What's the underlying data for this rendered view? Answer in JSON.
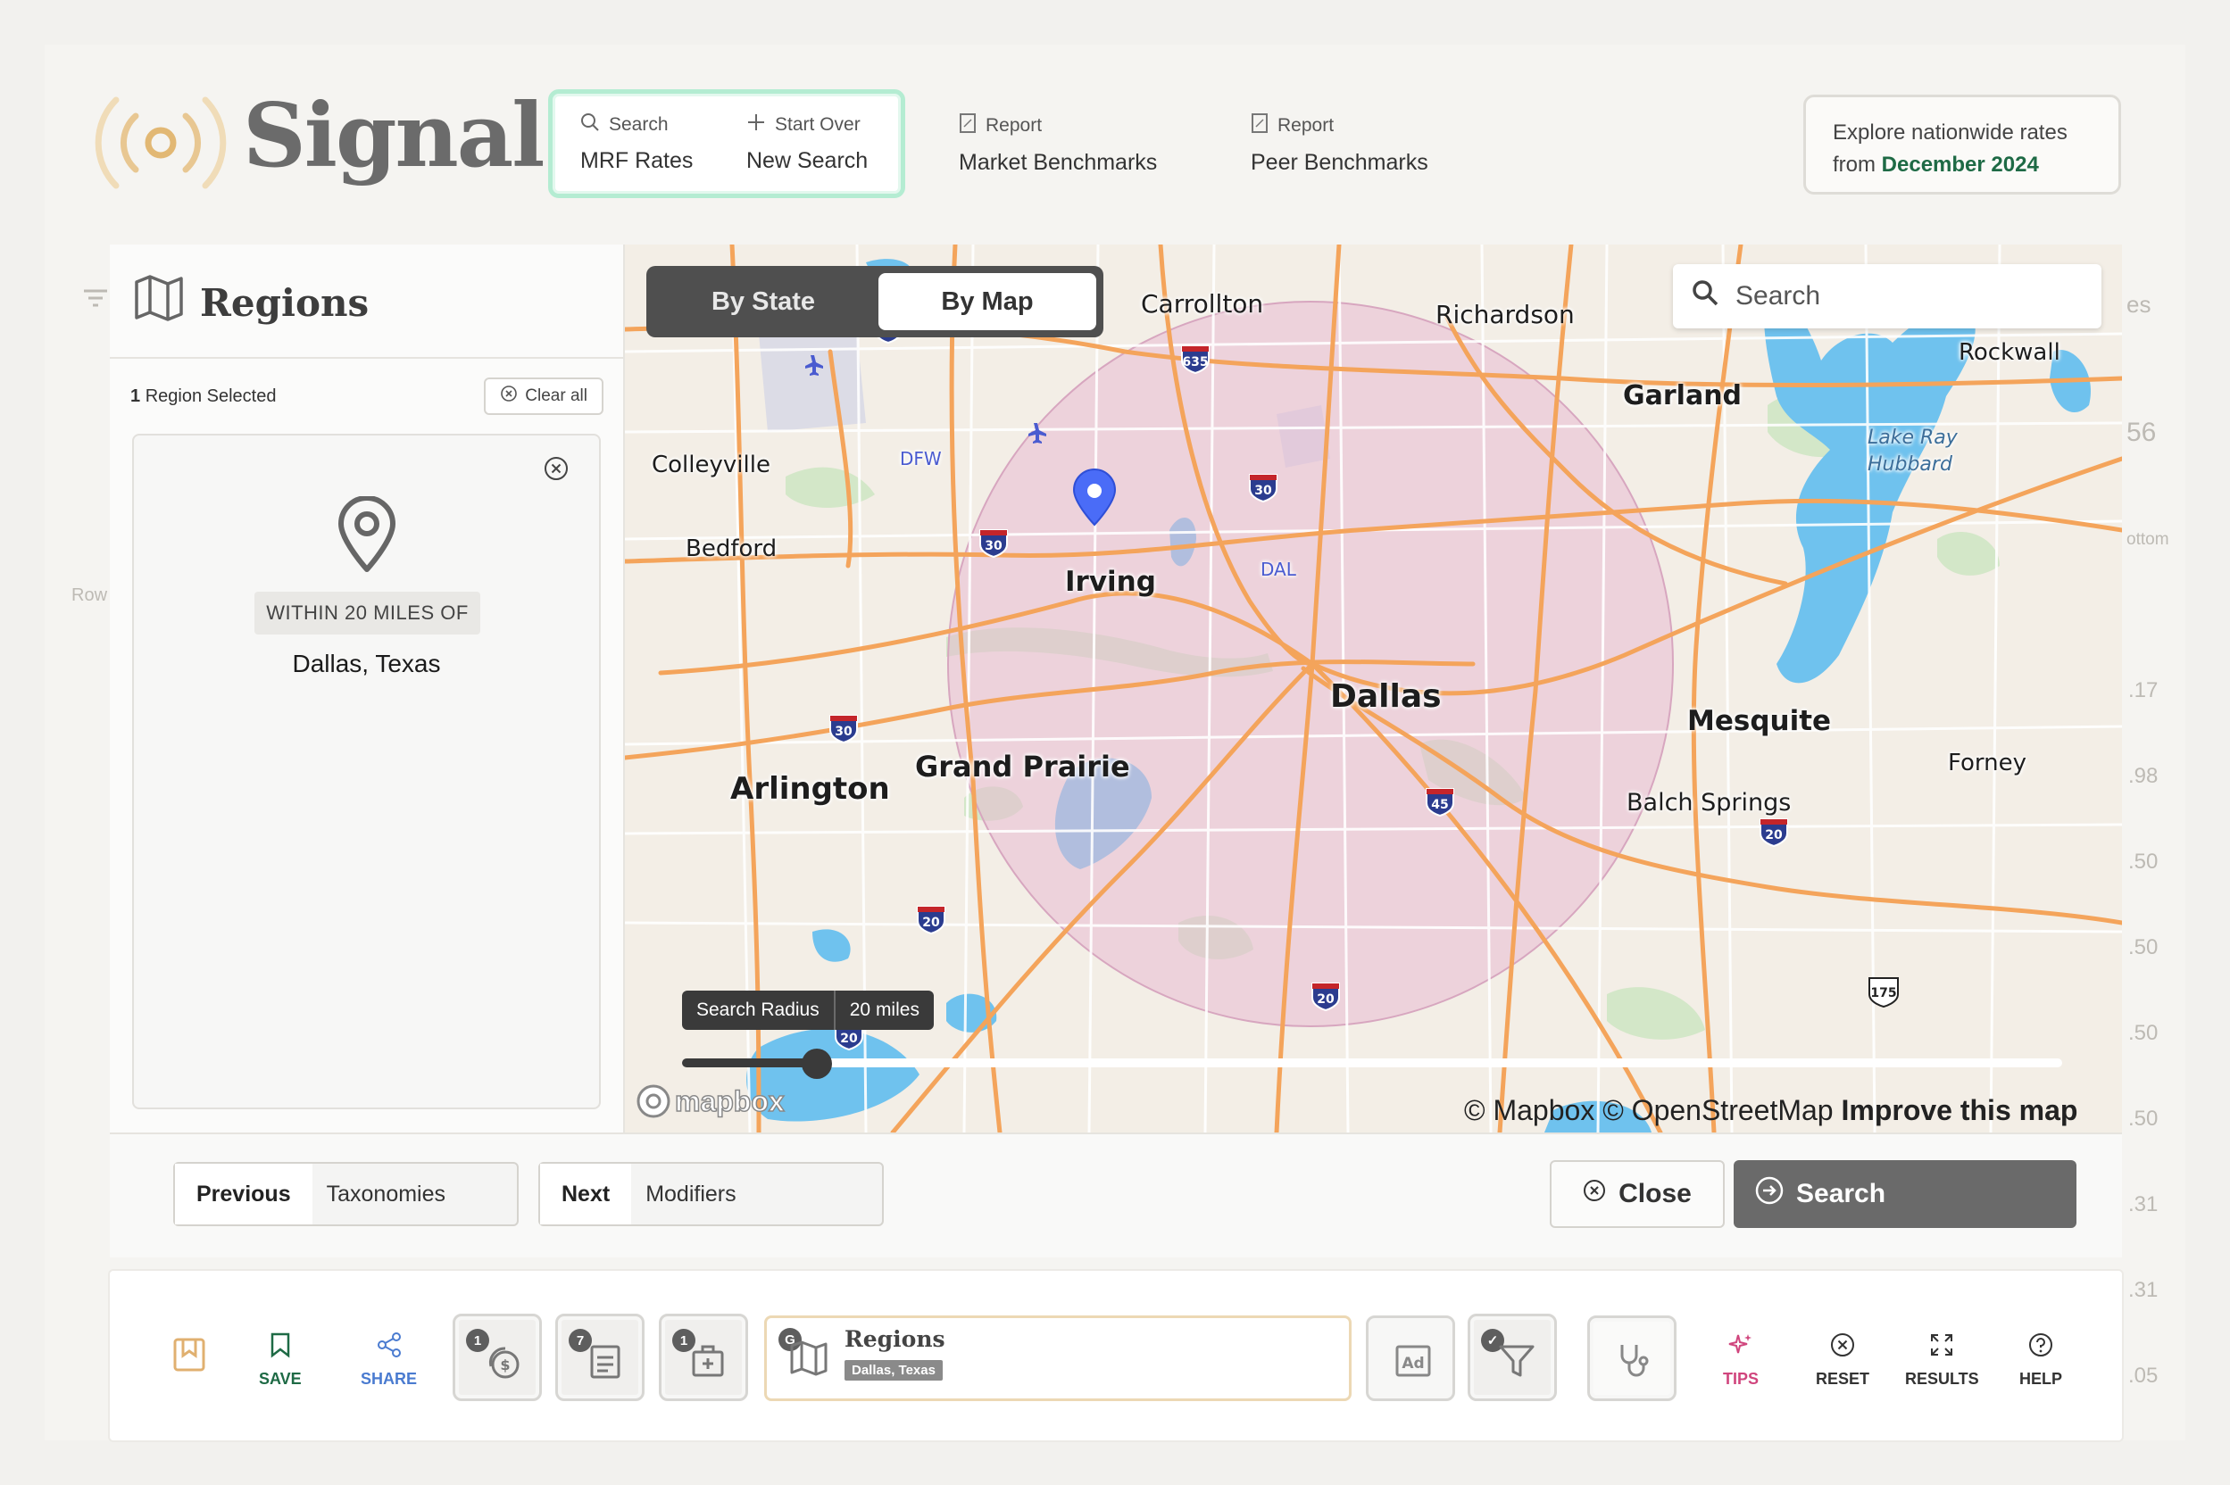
{
  "brand": {
    "name": "Signal"
  },
  "header_nav": [
    {
      "small": "Search",
      "big": "MRF Rates",
      "icon": "search-icon"
    },
    {
      "small": "Start Over",
      "big": "New Search",
      "icon": "plus-icon"
    },
    {
      "small": "Report",
      "big": "Market Benchmarks",
      "icon": "report-icon"
    },
    {
      "small": "Report",
      "big": "Peer Benchmarks",
      "icon": "report-icon"
    }
  ],
  "explore": {
    "line1": "Explore nationwide rates",
    "prefix": "from",
    "date": "December 2024"
  },
  "regions_panel": {
    "title": "Regions",
    "selected_count": "1",
    "selected_text": "Region Selected",
    "clear_all": "Clear all",
    "within": "WITHIN 20 MILES OF",
    "place": "Dallas, Texas"
  },
  "map": {
    "toggle": {
      "by_state": "By State",
      "by_map": "By Map",
      "active": "By Map"
    },
    "search_placeholder": "Search",
    "radius_label": "Search Radius",
    "radius_value": "20 miles",
    "radius_miles": 20,
    "mapbox_logo": "mapbox",
    "attribution": {
      "mapbox": "© Mapbox",
      "osm": "© OpenStreetMap",
      "improve": "Improve this map"
    },
    "cities": [
      "Carrollton",
      "Richardson",
      "Garland",
      "Rockwall",
      "Lake Ray Hubbard",
      "Colleyville",
      "Bedford",
      "Irving",
      "Dallas",
      "Mesquite",
      "Forney",
      "Balch Springs",
      "Grand Prairie",
      "Arlington",
      "DFW",
      "DAL"
    ],
    "shields": [
      "635",
      "635",
      "30",
      "30",
      "30",
      "45",
      "20",
      "20",
      "20",
      "20",
      "175"
    ]
  },
  "footer_nav": {
    "previous_label": "Previous",
    "previous_value": "Taxonomies",
    "next_label": "Next",
    "next_value": "Modifiers",
    "close": "Close",
    "search": "Search"
  },
  "toolbar": {
    "save": "SAVE",
    "share": "SHARE",
    "badges": [
      "1",
      "7",
      "1",
      "G"
    ],
    "regions_title": "Regions",
    "regions_tag": "Dallas, Texas",
    "tips": "TIPS",
    "reset": "RESET",
    "results": "RESULTS",
    "help": "HELP"
  },
  "background": {
    "right_edge_values": [
      ".17",
      ".98",
      ".50",
      ".50",
      ".50",
      ".50",
      ".31",
      ".31",
      ".05"
    ],
    "right_edge_labels": [
      "es",
      "56",
      "ottom"
    ],
    "left_edge_labels": [
      "Row"
    ]
  },
  "colors": {
    "accent_green": "#1e6a45",
    "active_border": "#b4ecd2",
    "radius_fill": "#e7bcd2",
    "pin": "#4a6cf7"
  }
}
